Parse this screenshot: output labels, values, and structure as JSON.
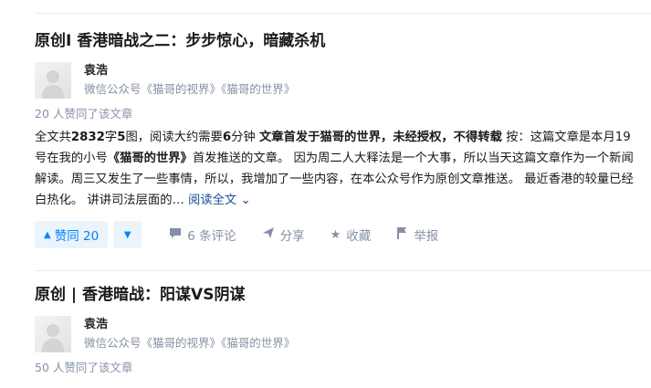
{
  "article1": {
    "title": "原创I 香港暗战之二：步步惊心，暗藏杀机",
    "author": "袁浩",
    "bio": "微信公众号《猫哥的视界》《猫哥的世界》",
    "votes_text": "20 人赞同了该文章",
    "excerpt": {
      "p1": "全文共",
      "b1": "2832",
      "p2": "字",
      "b2": "5",
      "p3": "图，阅读大约需要",
      "b3": "6",
      "p4": "分钟 ",
      "b4": "文章首发于猫哥的世界，未经授权，不得转载",
      "p5": " 按：这篇文章是本月19号在我的小号",
      "b5": "《猫哥的世界》",
      "p6": "首发推送的文章。 因为周二人大释法是一个大事，所以当天这篇文章作为一个新闻解读。周三又发生了一些事情，所以，我增加了一些内容，在本公众号作为原创文章推送。 最近香港的较量已经白热化。 讲讲司法层面的…",
      "read_more": " 阅读全文 ⌄"
    },
    "vote_label": "赞同 20",
    "comments_label": "6 条评论",
    "share_label": "分享",
    "collect_label": "收藏",
    "report_label": "举报"
  },
  "article2": {
    "title": "原创 | 香港暗战：阳谋VS阴谋",
    "author": "袁浩",
    "bio": "微信公众号《猫哥的视界》《猫哥的世界》",
    "votes_text": "50 人赞同了该文章"
  },
  "icons": {
    "comment": "comment-icon",
    "share": "share-icon",
    "collect": "star-icon",
    "report": "flag-icon"
  },
  "colors": {
    "accent": "#0084ff",
    "muted": "#8590a6",
    "vote_bg": "#ebf3fb"
  }
}
